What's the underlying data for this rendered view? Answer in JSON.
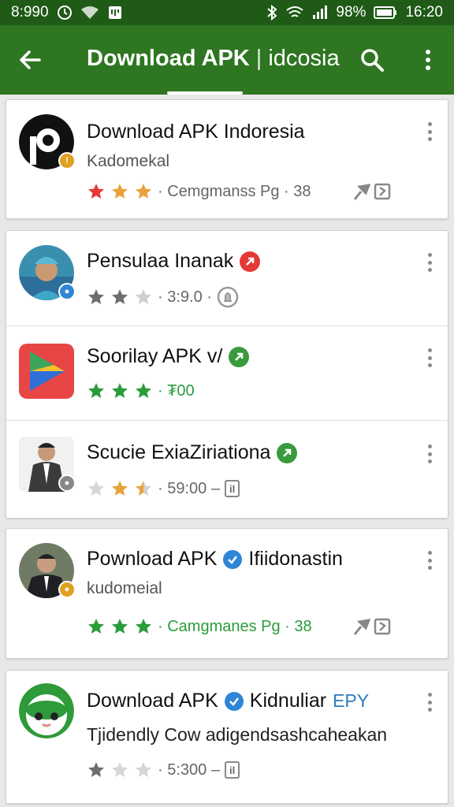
{
  "status_bar": {
    "time_left": "8:990",
    "battery": "98%",
    "time_right": "16:20"
  },
  "app_bar": {
    "title": "Download APK",
    "separator": "|",
    "subtitle": "idcosia"
  },
  "apps": [
    {
      "name": "Download APK Indoresia",
      "developer": "Kadomekal",
      "meta": "· Cemgmanss Pg · 38",
      "stars": [
        "red",
        "orange",
        "orange"
      ],
      "badge_color": "#e0a020"
    },
    {
      "name": "Pensulaa Inanak",
      "meta": "· 3:9.0 ·",
      "stars": [
        "gray",
        "gray",
        "light"
      ],
      "badge_color": "#2f86d6",
      "verify_color": "#e53935"
    },
    {
      "name": "Soorilay APK v/",
      "meta_green": "· ₮00",
      "stars": [
        "green",
        "green",
        "green"
      ],
      "verify_color": "#3a9a3e"
    },
    {
      "name": "Scucie ExiaΖiriationa",
      "meta": "· 59:00 –",
      "chip": "il",
      "stars": [
        "light",
        "orange",
        "half"
      ],
      "badge_color": "#888888",
      "verify_color": "#3a9a3e"
    },
    {
      "name": "Pownload APK",
      "name_suffix": "Ifiidonastin",
      "developer": "kudomeial",
      "meta_green": "· Camgmanes Pg · 38",
      "stars": [
        "green",
        "green",
        "green"
      ],
      "badge_color": "#e0a020",
      "verify_color": "#2f86d6"
    },
    {
      "name": "Download APK",
      "name_suffix": "Kidnuliar",
      "tag": "EPY",
      "developer": "Tjidendly Cow adigendsashcaheakan",
      "meta": "· 5:300 –",
      "chip": "il",
      "stars": [
        "gray",
        "light",
        "light"
      ],
      "verify_color": "#2f86d6"
    }
  ],
  "colors": {
    "status_bar": "#1f5a17",
    "app_bar": "#2e7621",
    "green_text": "#2a9d3a"
  }
}
